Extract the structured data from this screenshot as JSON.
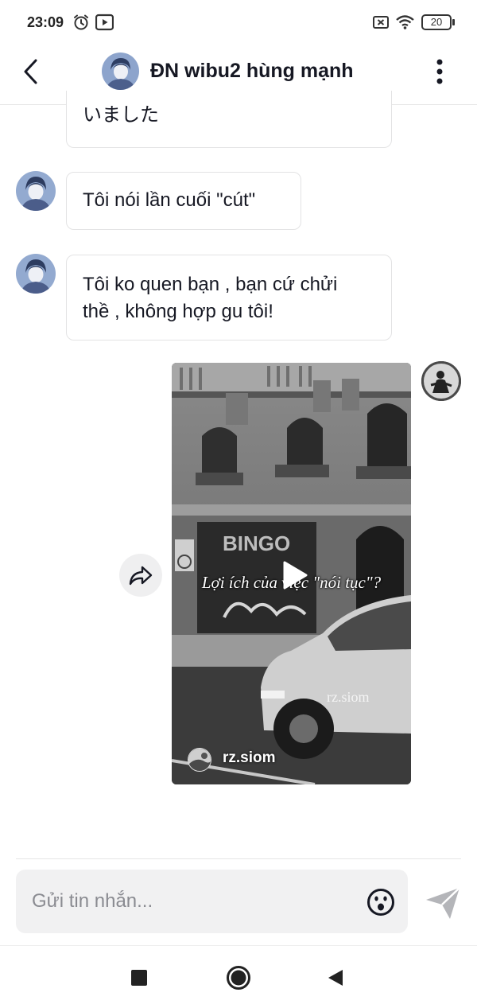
{
  "status_bar": {
    "time": "23:09",
    "battery": "20",
    "icons": [
      "alarm-icon",
      "youtube-icon",
      "sim-off-icon",
      "wifi-icon",
      "battery-icon"
    ]
  },
  "header": {
    "title": "ĐN wibu2 hùng mạnh",
    "back_icon": "chevron-left-icon",
    "more_icon": "more-vertical-icon"
  },
  "messages": [
    {
      "sender": "other",
      "lines": [
        "いました"
      ]
    },
    {
      "sender": "other",
      "lines": [
        "Tôi nói lần cuối \"cút\""
      ]
    },
    {
      "sender": "other",
      "lines": [
        "Tôi ko quen bạn , bạn cứ chửi",
        "thề , không hợp gu tôi!"
      ]
    }
  ],
  "shared_video": {
    "sender": "me",
    "caption": "Lợi ích của việc \"nói tục\"?",
    "storefront_sign": "BINGO",
    "watermark": "rz.siom",
    "author": "rz.siom",
    "play_icon": "play-icon",
    "share_icon": "share-forward-icon"
  },
  "composer": {
    "placeholder": "Gửi tin nhắn...",
    "emoji_icon": "emoji-icon",
    "send_icon": "send-icon"
  },
  "nav_bar": {
    "icons": [
      "recents-square-icon",
      "home-circle-icon",
      "back-triangle-icon"
    ]
  },
  "colors": {
    "text": "#161823",
    "bubble_border": "#e3e3e4",
    "composer_bg": "#f1f1f2",
    "placeholder": "#8a8b91",
    "send_icon": "#a8a9ad"
  }
}
